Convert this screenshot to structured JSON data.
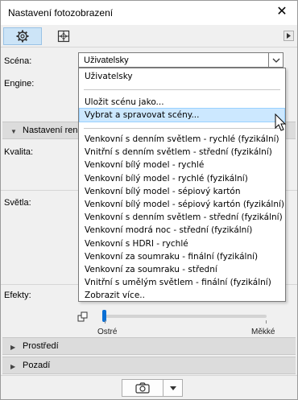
{
  "window": {
    "title": "Nastavení fotozobrazení",
    "close_glyph": "✕"
  },
  "toolbar": {
    "icons": [
      "gear-icon",
      "grid-icon"
    ],
    "scroll_glyph": "▶"
  },
  "scene": {
    "label": "Scéna:",
    "value": "Uživatelsky"
  },
  "labels": {
    "engine": "Engine:",
    "kvalita": "Kvalita:",
    "svetla": "Světla:",
    "efekty": "Efekty:"
  },
  "section_rendering": {
    "label": "Nastavení ren"
  },
  "slider": {
    "min_label": "Ostré",
    "max_label": "Měkké",
    "value_fraction": 0.0
  },
  "sections": [
    {
      "label": "Prostředí"
    },
    {
      "label": "Pozadí"
    }
  ],
  "dropdown": {
    "top_item": "Uživatelsky",
    "save_item": "Uložit scénu jako...",
    "manage_item": "Vybrat a spravovat scény...",
    "scenes": [
      "Venkovní s denním světlem - rychlé (fyzikální)",
      "Vnitřní s denním světlem - střední (fyzikální)",
      "Venkovní bílý model - rychlé",
      "Venkovní bílý model - rychlé (fyzikální)",
      "Venkovní bílý model - sépiový kartón",
      "Venkovní bílý model - sépiový kartón (fyzikální)",
      "Venkovní s denním světlem - střední (fyzikální)",
      "Venkovní modrá noc - střední (fyzikální)",
      "Venkovní s HDRI - rychlé",
      "Venkovní za soumraku - finální (fyzikální)",
      "Venkovní za soumraku - střední",
      "Vnitřní s umělým světlem - finální (fyzikální)",
      "Zobrazit více.."
    ]
  },
  "colors": {
    "accent": "#0a6fd4",
    "highlight": "#cce8ff",
    "toolbar_active": "#cce4f7"
  }
}
